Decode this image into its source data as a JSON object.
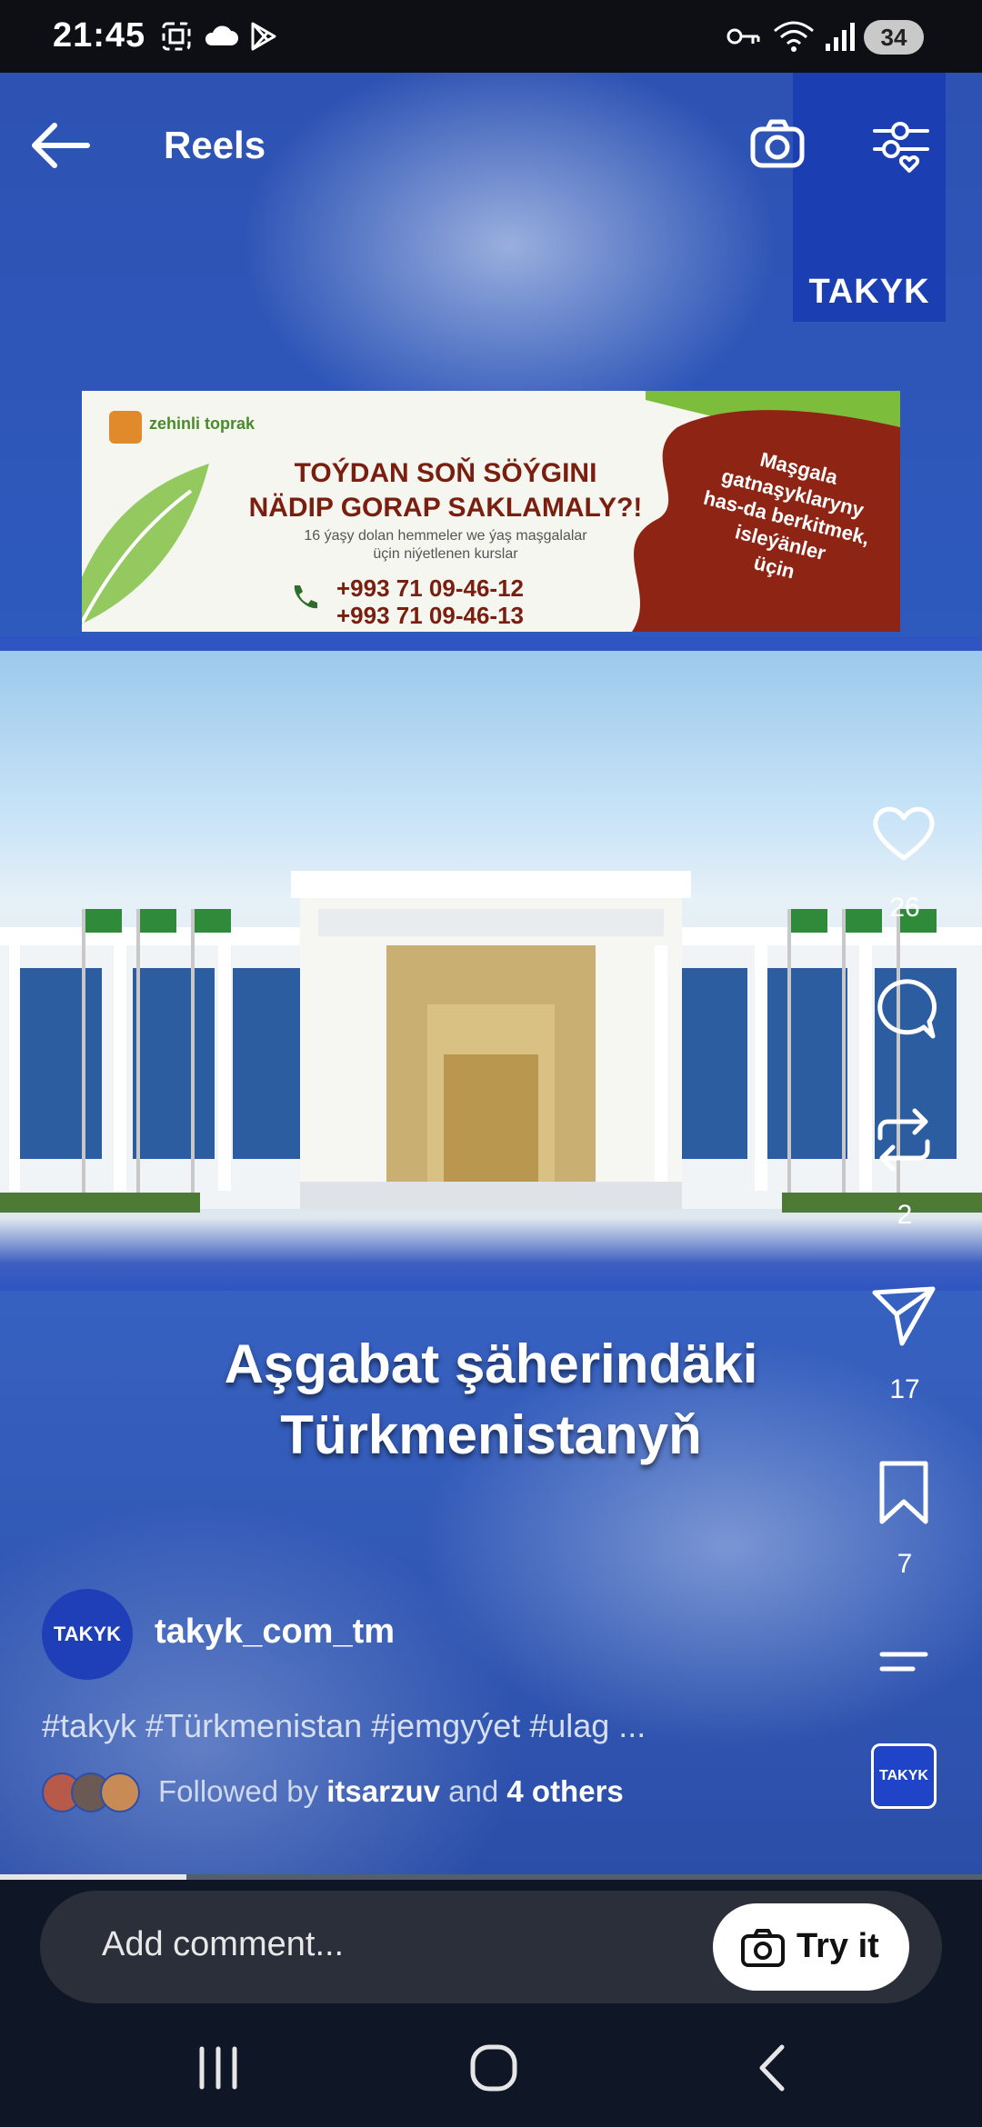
{
  "status_bar": {
    "time": "21:45",
    "battery": "34"
  },
  "header": {
    "title": "Reels",
    "brand_tag": "TAKYK"
  },
  "ad_banner": {
    "logo_text": "zehinli toprak",
    "headline_line1": "TOÝDAN SOŇ SÖÝGINI",
    "headline_line2": "NÄDIP GORAP SAKLAMALY?!",
    "sub_line1": "16 ýaşy dolan hemmeler we ýaş maşgalalar",
    "sub_line2": "üçin niýetlenen kurslar",
    "phone1": "+993 71 09-46-12",
    "phone2": "+993 71 09-46-13",
    "side_line1": "Maşgala",
    "side_line2": "gatnaşyklaryny",
    "side_line3": "has-da berkitmek,",
    "side_line4": "isleýänler",
    "side_line5": "üçin"
  },
  "video_caption": {
    "line1": "Aşgabat şäherindäki",
    "line2": "Türkmenistanyň"
  },
  "rail": {
    "likes": "26",
    "reposts": "2",
    "shares": "17",
    "saves": "7",
    "avatar_text": "TAKYK"
  },
  "author": {
    "avatar_text": "TAKYK",
    "username": "takyk_com_tm",
    "hashtags": "#takyk #Türkmenistan #jemgyýet #ulag ...",
    "followed_prefix": "Followed by",
    "followed_user": "itsarzuv",
    "followed_and": "and",
    "followed_others": "4 others"
  },
  "progress": {
    "fraction": 0.19
  },
  "comment": {
    "placeholder": "Add comment...",
    "try_label": "Try it"
  },
  "colors": {
    "brand_blue": "#1b3fb2",
    "ad_red": "#8e2414",
    "ad_green": "#7cbe3c"
  }
}
